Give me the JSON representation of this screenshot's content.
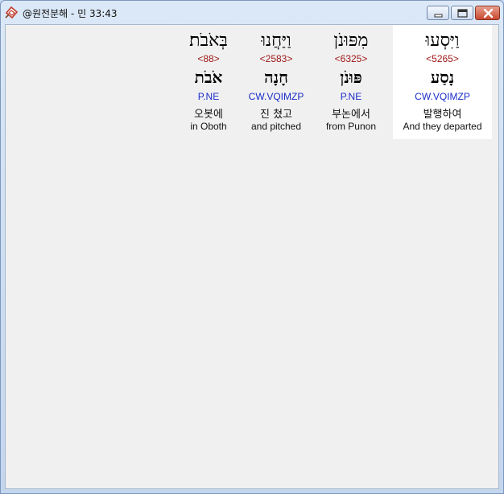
{
  "window": {
    "title": "@원전분해 - 민 33:43"
  },
  "columns": [
    {
      "hebrew": "וַיִּסְעוּ",
      "strong": "<5265>",
      "lemma": "נָסַע",
      "morph": "CW.VQIMZP",
      "korean": "발행하여",
      "english": "And they departed",
      "selected": true
    },
    {
      "hebrew": "מִפּוּנֹן",
      "strong": "<6325>",
      "lemma": "פּוּנֹן",
      "morph": "P.NE",
      "korean": "부논에서",
      "english": "from Punon",
      "selected": false
    },
    {
      "hebrew": "וַיַּחֲנוּ",
      "strong": "<2583>",
      "lemma": "חָנָה",
      "morph": "CW.VQIMZP",
      "korean": "진 쳤고",
      "english": "and pitched",
      "selected": false
    },
    {
      "hebrew": "בְּאֹבֹת׃",
      "strong": "<88>",
      "lemma": "אֹבֹת",
      "morph": "P.NE",
      "korean": "오봇에",
      "english": "in Oboth",
      "selected": false
    }
  ]
}
